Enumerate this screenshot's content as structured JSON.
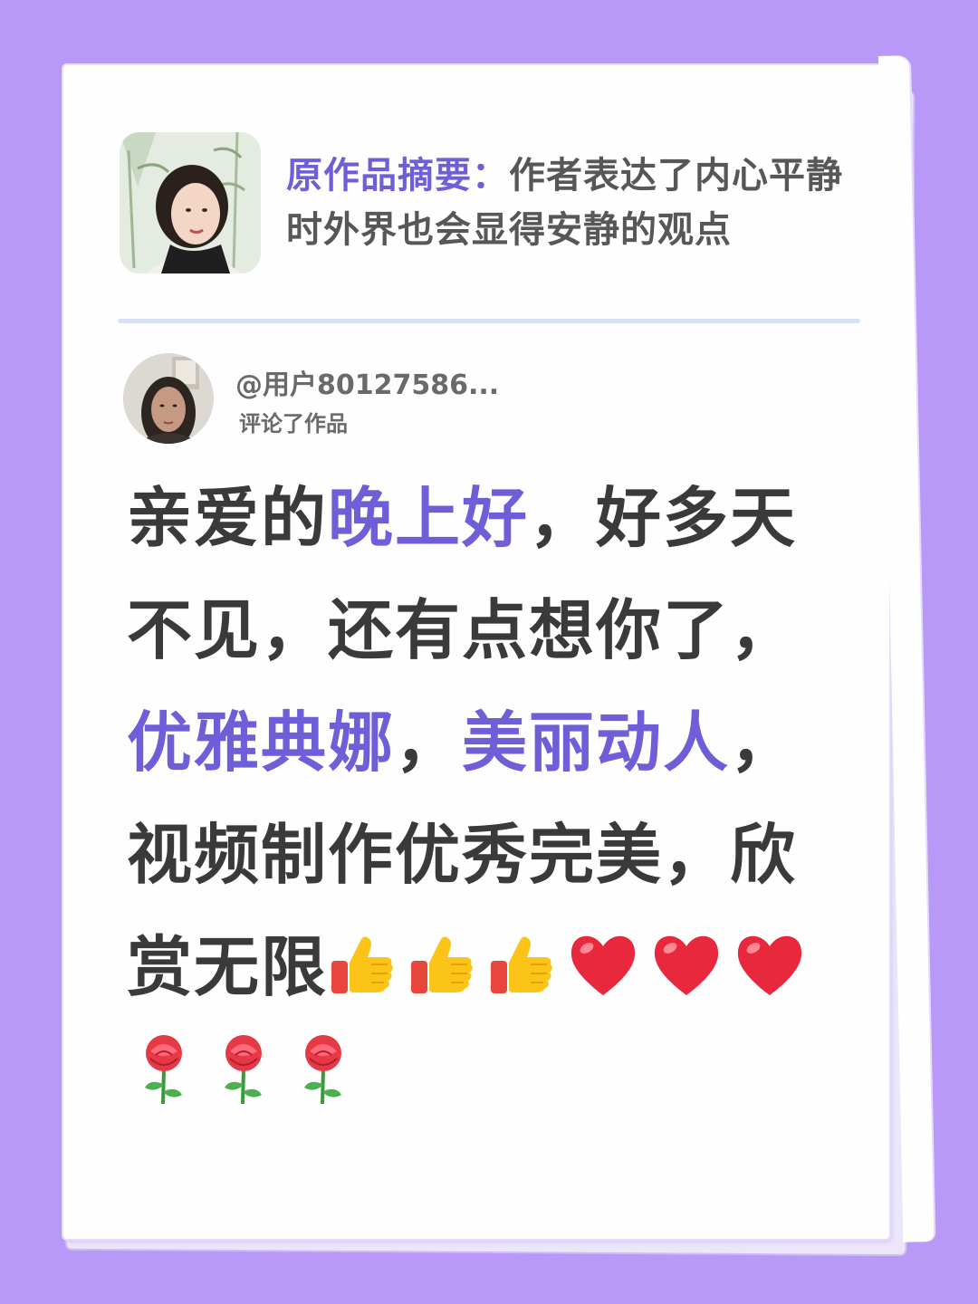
{
  "summary": {
    "label": "原作品摘要：",
    "text": "作者表达了内心平静时外界也会显得安静的观点"
  },
  "commenter": {
    "name": "@用户80127586...",
    "action": "评论了作品"
  },
  "comment": {
    "p1": "亲爱的",
    "h1": "晚上好",
    "p2": "，好多天不见，还有点想你了，",
    "h2": "优雅典娜",
    "p3": "，",
    "h3": "美丽动人",
    "p4": "，视频制作优秀完美，欣赏无限"
  },
  "icons": {
    "thumbs": [
      "thumbs-up-icon",
      "thumbs-up-icon",
      "thumbs-up-icon"
    ],
    "hearts": [
      "heart-icon",
      "heart-icon",
      "heart-icon"
    ],
    "roses": [
      "rose-icon",
      "rose-icon",
      "rose-icon"
    ]
  },
  "colors": {
    "background": "#b899f7",
    "accent": "#6e5fd8",
    "text": "#3a3a3a"
  }
}
